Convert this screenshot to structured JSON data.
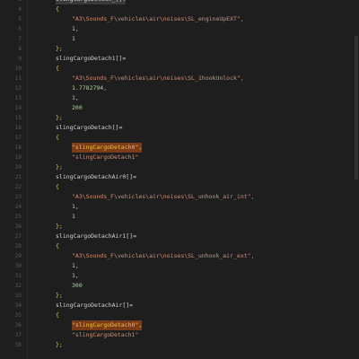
{
  "editor": {
    "lines": [
      {
        "no": "3",
        "text": "slingCargoDetach_[]:",
        "kind": "hl-first"
      },
      {
        "no": "4",
        "text": "{",
        "kind": "brace"
      },
      {
        "no": "5",
        "text": "\"A3\\Sounds_F\\vehicles\\air\\noises\\SL_engineUpEXT\",",
        "kind": "str"
      },
      {
        "no": "6",
        "text": "1,",
        "kind": "num"
      },
      {
        "no": "7",
        "text": "1",
        "kind": "num"
      },
      {
        "no": "8",
        "text": "};",
        "kind": "brace"
      },
      {
        "no": "9",
        "text": "slingCargoDetach1[]=",
        "kind": "ident"
      },
      {
        "no": "10",
        "text": "{",
        "kind": "brace"
      },
      {
        "no": "11",
        "text": "\"A3\\Sounds_F\\vehicles\\air\\noises\\SL_1hookUnlock\",",
        "kind": "str"
      },
      {
        "no": "12",
        "text": "1.7782794,",
        "kind": "num"
      },
      {
        "no": "13",
        "text": "1,",
        "kind": "num"
      },
      {
        "no": "14",
        "text": "200",
        "kind": "num"
      },
      {
        "no": "15",
        "text": "};",
        "kind": "brace"
      },
      {
        "no": "16",
        "text": "slingCargoDetach[]=",
        "kind": "ident"
      },
      {
        "no": "17",
        "text": "{",
        "kind": "brace"
      },
      {
        "no": "18",
        "text": "\"slingCargoDetach0\",",
        "kind": "hl"
      },
      {
        "no": "19",
        "text": "\"slingCargoDetach1\"",
        "kind": "str"
      },
      {
        "no": "20",
        "text": "};",
        "kind": "brace"
      },
      {
        "no": "21",
        "text": "slingCargoDetachAir0[]=",
        "kind": "ident"
      },
      {
        "no": "22",
        "text": "{",
        "kind": "brace"
      },
      {
        "no": "23",
        "text": "\"A3\\Sounds_F\\vehicles\\air\\noises\\SL_unhook_air_int\",",
        "kind": "str"
      },
      {
        "no": "24",
        "text": "1,",
        "kind": "num"
      },
      {
        "no": "25",
        "text": "1",
        "kind": "num"
      },
      {
        "no": "26",
        "text": "};",
        "kind": "brace"
      },
      {
        "no": "27",
        "text": "slingCargoDetachAir1[]=",
        "kind": "ident"
      },
      {
        "no": "28",
        "text": "{",
        "kind": "brace"
      },
      {
        "no": "29",
        "text": "\"A3\\Sounds_F\\vehicles\\air\\noises\\SL_unhook_air_ext\",",
        "kind": "str"
      },
      {
        "no": "30",
        "text": "1,",
        "kind": "num"
      },
      {
        "no": "31",
        "text": "1,",
        "kind": "num"
      },
      {
        "no": "32",
        "text": "300",
        "kind": "num"
      },
      {
        "no": "33",
        "text": "};",
        "kind": "brace"
      },
      {
        "no": "34",
        "text": "slingCargoDetachAir[]=",
        "kind": "ident"
      },
      {
        "no": "35",
        "text": "{",
        "kind": "brace"
      },
      {
        "no": "36",
        "text": "\"slingCargoDetach0\",",
        "kind": "hl"
      },
      {
        "no": "37",
        "text": "\"slingCargoDetach1\"",
        "kind": "str"
      },
      {
        "no": "38",
        "text": "};",
        "kind": "brace"
      }
    ]
  },
  "colors": {
    "background": "#1e1e1e",
    "string": "#ce9178",
    "number": "#b5cea8",
    "brace": "#e8c24a",
    "highlight": "#7a3b1a"
  }
}
